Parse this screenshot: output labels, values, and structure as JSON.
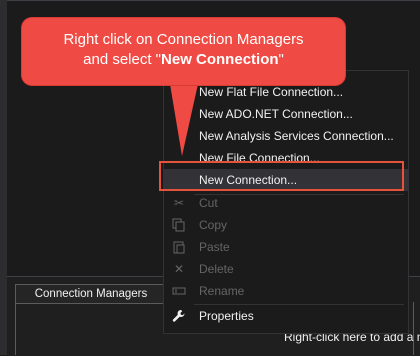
{
  "callout": {
    "line1": "Right click on Connection Managers",
    "line2_pre": "and select \"",
    "line2_bold": "New Connection",
    "line2_post": "\""
  },
  "menu": {
    "items": [
      {
        "label": "New Flat File Connection...",
        "enabled": true
      },
      {
        "label": "New ADO.NET Connection...",
        "enabled": true
      },
      {
        "label": "New Analysis Services Connection...",
        "enabled": true
      },
      {
        "label": "New File Connection...",
        "enabled": true
      },
      {
        "label": "New Connection...",
        "enabled": true,
        "highlighted": true
      },
      {
        "label": "Cut",
        "enabled": false,
        "icon": "scissors-icon"
      },
      {
        "label": "Copy",
        "enabled": false,
        "icon": "copy-icon"
      },
      {
        "label": "Paste",
        "enabled": false,
        "icon": "paste-icon"
      },
      {
        "label": "Delete",
        "enabled": false,
        "icon": "delete-icon"
      },
      {
        "label": "Rename",
        "enabled": false,
        "icon": "rename-icon"
      },
      {
        "label": "Properties",
        "enabled": true,
        "icon": "wrench-icon"
      }
    ]
  },
  "panel": {
    "tab_label": "Connection Managers",
    "hint": "Right-click here to add a new"
  },
  "colors": {
    "callout": "#ef4a43",
    "highlight_border": "#e5533d",
    "menu_bg": "#1b1b1c"
  }
}
